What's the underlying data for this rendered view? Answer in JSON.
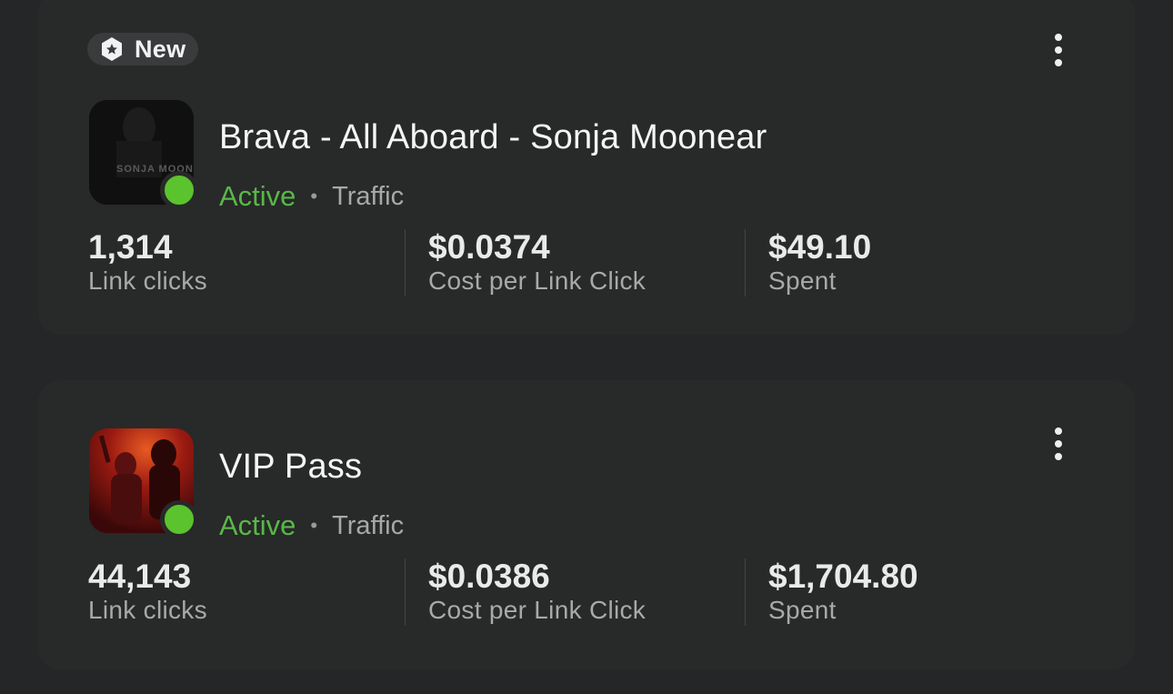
{
  "badge": {
    "label": "New",
    "icon": "sparkle-badge-icon"
  },
  "campaigns": [
    {
      "title": "Brava - All Aboard - Sonja Moonear",
      "thumbnail_text": "SONJA MOONE",
      "status": "Active",
      "objective": "Traffic",
      "metrics": [
        {
          "value": "1,314",
          "label": "Link clicks"
        },
        {
          "value": "$0.0374",
          "label": "Cost per Link Click"
        },
        {
          "value": "$49.10",
          "label": "Spent"
        }
      ]
    },
    {
      "title": "VIP Pass",
      "status": "Active",
      "objective": "Traffic",
      "metrics": [
        {
          "value": "44,143",
          "label": "Link clicks"
        },
        {
          "value": "$0.0386",
          "label": "Cost per Link Click"
        },
        {
          "value": "$1,704.80",
          "label": "Spent"
        }
      ]
    }
  ],
  "separator": "•",
  "colors": {
    "background": "#252627",
    "active_green": "#5bc32e",
    "status_text_green": "#58b848"
  }
}
